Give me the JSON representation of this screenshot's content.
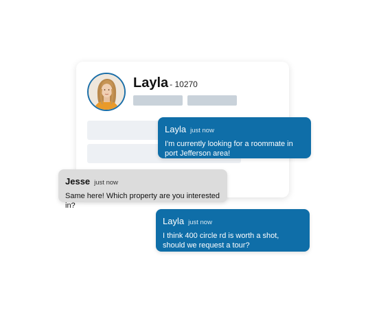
{
  "profile": {
    "name": "Layla",
    "id": "- 10270"
  },
  "messages": [
    {
      "sender": "Layla",
      "time": "just now",
      "text": "I'm currently looking for a roommate in port Jefferson area!"
    },
    {
      "sender": "Jesse",
      "time": "just now",
      "text": "Same here! Which property are you interested in?"
    },
    {
      "sender": "Layla",
      "time": "just now",
      "text": "I think 400 circle rd is worth a shot, should we request a tour?"
    }
  ],
  "colors": {
    "accent": "#0f6ea8",
    "bubble_gray": "#dcdcdc",
    "placeholder": "#c9d2da"
  }
}
